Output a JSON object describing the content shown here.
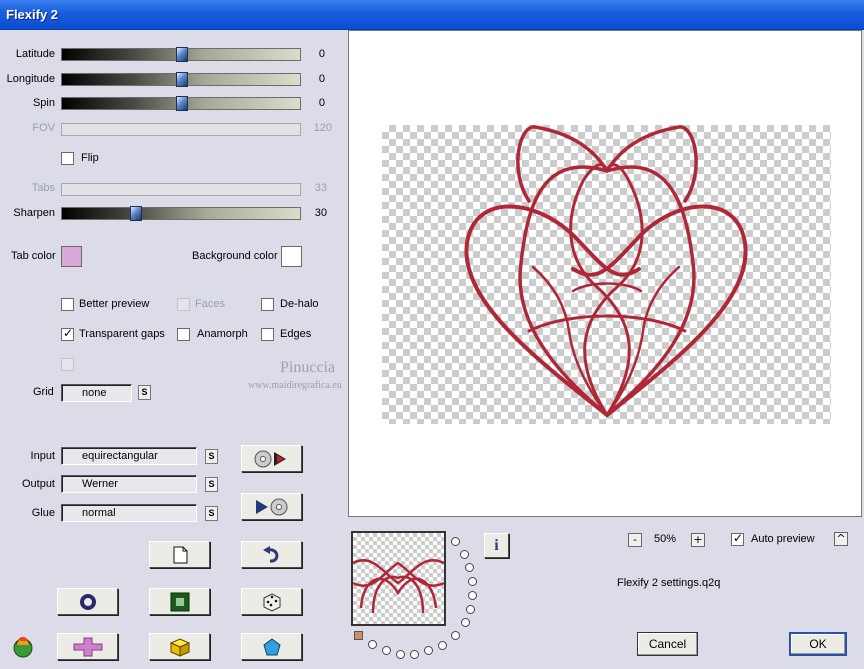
{
  "window": {
    "title": "Flexify 2"
  },
  "sliders": [
    {
      "label": "Latitude",
      "value": "0",
      "position": 0.5,
      "enabled": true
    },
    {
      "label": "Longitude",
      "value": "0",
      "position": 0.5,
      "enabled": true
    },
    {
      "label": "Spin",
      "value": "0",
      "position": 0.5,
      "enabled": true
    },
    {
      "label": "FOV",
      "value": "120",
      "enabled": false
    },
    {
      "label": "Tabs",
      "value": "33",
      "enabled": false
    },
    {
      "label": "Sharpen",
      "value": "30",
      "position": 0.3,
      "enabled": true
    }
  ],
  "flip": {
    "label": "Flip",
    "checked": false
  },
  "colors": {
    "tab_color_label": "Tab color",
    "tab_color": "#d8a8d8",
    "background_color_label": "Background color",
    "background_color": "#ffffff"
  },
  "options": {
    "better_preview": {
      "label": "Better preview",
      "checked": false
    },
    "faces": {
      "label": "Faces",
      "checked": false,
      "enabled": false
    },
    "de_halo": {
      "label": "De-halo",
      "checked": false
    },
    "transparent_gaps": {
      "label": "Transparent gaps",
      "checked": true
    },
    "anamorph": {
      "label": "Anamorph",
      "checked": false
    },
    "edges": {
      "label": "Edges",
      "checked": false
    }
  },
  "grid": {
    "label": "Grid",
    "value": "none",
    "s_label": "S"
  },
  "projection": {
    "input_label": "Input",
    "input_value": "equirectangular",
    "output_label": "Output",
    "output_value": "Werner",
    "glue_label": "Glue",
    "glue_value": "normal",
    "s_label": "S"
  },
  "watermark": {
    "name": "Pinuccia",
    "url": "www.maidiregrafica.eu"
  },
  "zoom": {
    "minus": "-",
    "value": "50%",
    "plus": "+"
  },
  "auto_preview": {
    "label": "Auto preview",
    "checked": true,
    "toggle": "^"
  },
  "settings_file": "Flexify 2 settings.q2q",
  "buttons": {
    "cancel": "Cancel",
    "ok": "OK",
    "info": "i"
  },
  "colors_theme": {
    "accent": "#b02838",
    "title_bar": "#0b4cd0",
    "dialog_bg": "#dcdbe8"
  }
}
